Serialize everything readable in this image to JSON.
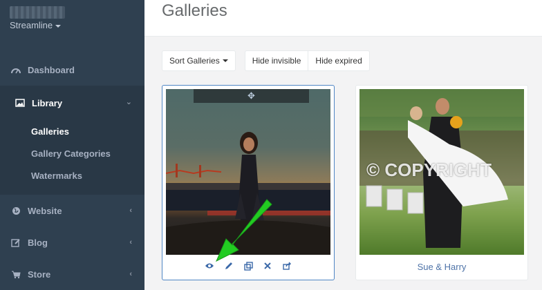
{
  "sidebar": {
    "brand_name": "Streamline",
    "nav": {
      "dashboard": "Dashboard",
      "library": "Library",
      "library_sub": {
        "galleries": "Galleries",
        "gallery_categories": "Gallery Categories",
        "watermarks": "Watermarks"
      },
      "website": "Website",
      "blog": "Blog",
      "store": "Store"
    }
  },
  "header": {
    "title": "Galleries"
  },
  "toolbar": {
    "sort_label": "Sort Galleries",
    "hide_invisible": "Hide invisible",
    "hide_expired": "Hide expired"
  },
  "galleries": [
    {
      "caption": "",
      "drag_icon": "move-icon",
      "actions": [
        "eye-icon",
        "pencil-icon",
        "copy-icon",
        "close-icon",
        "share-icon"
      ]
    },
    {
      "caption": "Sue & Harry",
      "watermark": "© COPYRIGHT"
    }
  ],
  "annotation": {
    "arrow_color": "#22cc22"
  }
}
